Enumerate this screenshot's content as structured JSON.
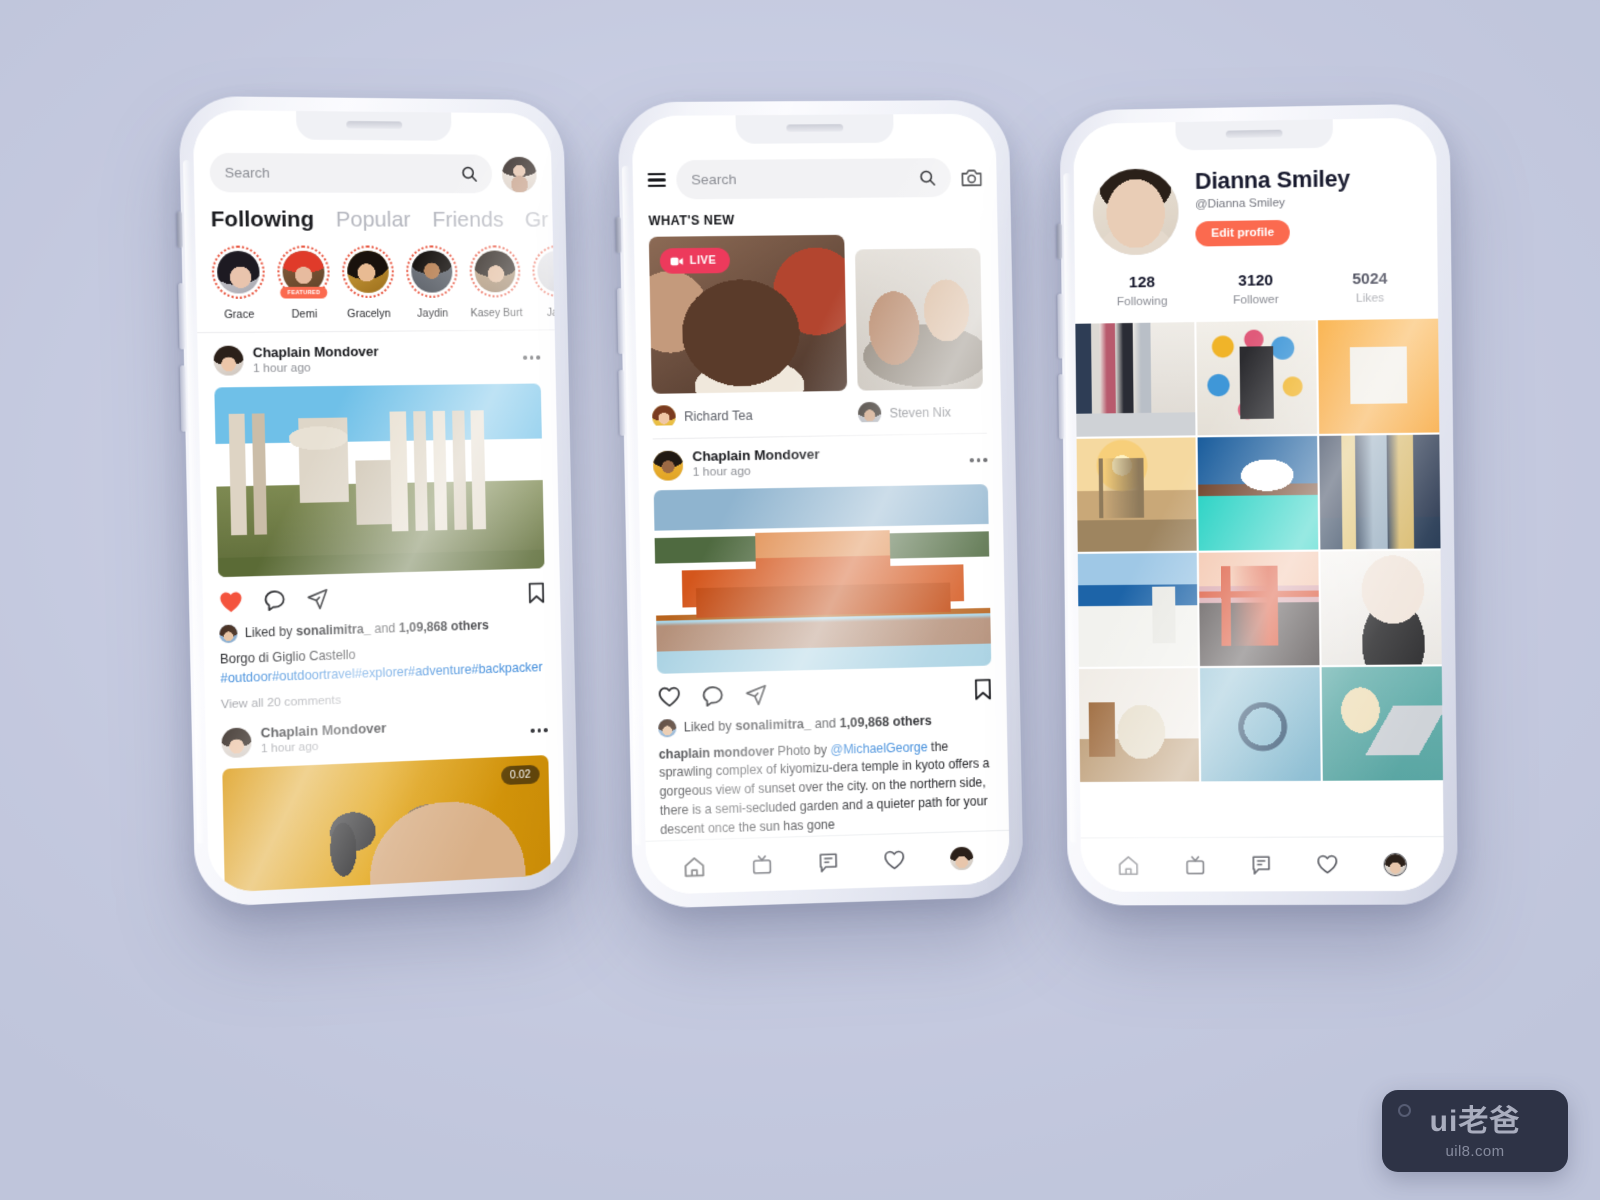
{
  "background_color": "#c9cee3",
  "accent_color": "#fb6a4f",
  "link_color": "#2f82d8",
  "live_color": "#ed3a5c",
  "phone1": {
    "search": {
      "placeholder": "Search",
      "icon": "search-icon"
    },
    "profile_icon": "user-avatar",
    "tabs": [
      {
        "label": "Following",
        "active": true
      },
      {
        "label": "Popular",
        "active": false
      },
      {
        "label": "Friends",
        "active": false
      },
      {
        "label": "Gr",
        "active": false
      }
    ],
    "stories": [
      {
        "name": "Grace",
        "featured": false
      },
      {
        "name": "Demi",
        "featured": true,
        "badge": "FEATURED"
      },
      {
        "name": "Gracelyn",
        "featured": false
      },
      {
        "name": "Jaydin",
        "featured": false
      },
      {
        "name": "Kasey Burt",
        "featured": false
      },
      {
        "name": "Jane",
        "featured": false
      }
    ],
    "post1": {
      "author": "Chaplain Mondover",
      "time": "1 hour ago",
      "menu_icon": "more-options-icon",
      "image_alt": "roman-forum-ruins",
      "actions": {
        "like": "heart-icon-filled",
        "comment": "comment-icon",
        "share": "share-icon",
        "save": "bookmark-icon"
      },
      "liked_prefix": "Liked by ",
      "liked_user": "sonalimitra_",
      "liked_middle": " and ",
      "liked_count": "1,09,868 others",
      "caption_title": "Borgo di Giglio Castello",
      "caption_tags": "#outdoor#outdoortravel#explorer#adventure#backpacker",
      "comments_link": "View all 20 comments"
    },
    "post2": {
      "author": "Chaplain Mondover",
      "time": "1 hour ago",
      "timer": "0.02",
      "image_alt": "podcast-microphone-man"
    }
  },
  "phone2": {
    "menu_icon": "hamburger-menu-icon",
    "search": {
      "placeholder": "Search",
      "icon": "search-icon"
    },
    "camera_icon": "camera-icon",
    "section_title": "WHAT'S NEW",
    "cards": [
      {
        "user": "Richard Tea",
        "live_badge": "LIVE",
        "image_alt": "birthday-party-celebration"
      },
      {
        "user": "Steven Nix",
        "live_badge": "",
        "image_alt": "friends-on-couch"
      }
    ],
    "post": {
      "author": "Chaplain Mondover",
      "time": "1 hour ago",
      "menu_icon": "more-options-icon",
      "image_alt": "byodo-in-temple-kyoto",
      "liked_prefix": "Liked by ",
      "liked_user": "sonalimitra_",
      "liked_middle": " and ",
      "liked_count": "1,09,868 others",
      "caption_user": "chaplain mondover",
      "caption_pre": " Photo by ",
      "caption_mention": "@MichaelGeorge",
      "caption_body": " the sprawling complex of kiyomizu-dera temple in kyoto offers a gorgeous view of sunset over the city. on the northern side, there is a semi-secluded garden and a quieter path for your descent once the sun has gone"
    },
    "tabbar": [
      "home-icon",
      "tv-icon",
      "chat-icon",
      "heart-icon",
      "profile-avatar"
    ]
  },
  "phone3": {
    "name": "Dianna Smiley",
    "handle": "@Dianna Smiley",
    "edit_button": "Edit profile",
    "avatar_alt": "dianna-portrait",
    "stats": [
      {
        "value": "128",
        "label": "Following"
      },
      {
        "value": "3120",
        "label": "Follower"
      },
      {
        "value": "5024",
        "label": "Likes"
      }
    ],
    "grid": [
      "team-of-women-office",
      "phone-app-icons",
      "tools-blueprint-orange",
      "cairo-sunset-mosque",
      "maldives-overwater-villas",
      "dubai-skyline-night",
      "santorini-greece",
      "golden-gate-bridge-sunset",
      "woman-mask-thumbs-up",
      "armchair-interior",
      "stethoscope-medical",
      "laptop-popcorn-movie"
    ],
    "tabbar": [
      "home-icon",
      "tv-icon",
      "chat-icon",
      "heart-icon",
      "profile-avatar"
    ]
  },
  "watermark": {
    "brand": "ui",
    "brand_cn": "老爸",
    "site": "uil8.com"
  }
}
